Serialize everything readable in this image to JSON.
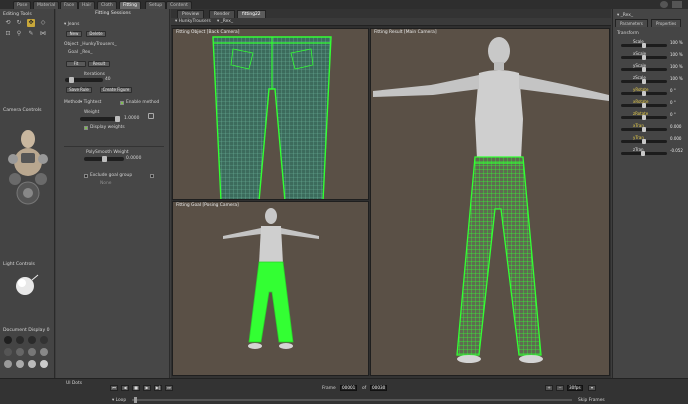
{
  "top_tabs": [
    "Pose",
    "Material",
    "Face",
    "Hair",
    "Cloth",
    "Fitting",
    "Setup",
    "Content"
  ],
  "active_top_tab": "Fitting",
  "left_panels": {
    "editing_tools": "Editing Tools",
    "camera_controls": "Camera Controls",
    "light_controls": "Light Controls",
    "document_display": "Document Display",
    "document_display_badge": "0"
  },
  "fitting": {
    "title": "Fitting Sessions",
    "session_name": "Jeans",
    "new_label": "New",
    "delete_label": "Delete",
    "object_label": "Object",
    "object_value": "_HunkyTrousers_",
    "goal_label": "Goal",
    "goal_value": "_Rex_",
    "fit_label": "Fit",
    "result_label": "Result",
    "iterations_label": "Iterations",
    "iterations_value": "40",
    "save_rule_label": "Save Rule",
    "create_figure_label": "Create Figure",
    "method_label": "Method",
    "method_value": "Tightest",
    "enable_method_label": "Enable method",
    "weight_label": "Weight",
    "weight_value": "1.0000",
    "display_weights_label": "Display weights",
    "polysmooth_label": "PolySmooth Weight",
    "polysmooth_value": "0.0000",
    "exclude_goal_label": "Exclude goal group",
    "none_label": "None"
  },
  "viewport": {
    "tabs": [
      "Preview",
      "Render",
      "fitting22"
    ],
    "active_tab": "fitting22",
    "object_selector": "HunkyTrousers",
    "figure_selector": "_Rex_",
    "views": {
      "object_view": "Fitting Object [Back Camera]",
      "result_view": "Fitting Result [Main Camera]",
      "goal_view": "Fitting Goal [Posing Camera]"
    }
  },
  "right_panel": {
    "figure": "_Rex_",
    "tabs": [
      "Parameters",
      "Properties"
    ],
    "section": "Transform",
    "params": [
      {
        "name": "Scale",
        "value": "100 %",
        "level": 0.5,
        "highlight": false
      },
      {
        "name": "xScale",
        "value": "100 %",
        "level": 0.5,
        "highlight": false
      },
      {
        "name": "yScale",
        "value": "100 %",
        "level": 0.5,
        "highlight": false
      },
      {
        "name": "zScale",
        "value": "100 %",
        "level": 0.5,
        "highlight": false
      },
      {
        "name": "yRotate",
        "value": "0 °",
        "level": 0.5,
        "highlight": true
      },
      {
        "name": "xRotate",
        "value": "0 °",
        "level": 0.5,
        "highlight": true
      },
      {
        "name": "zRotate",
        "value": "0 °",
        "level": 0.5,
        "highlight": true
      },
      {
        "name": "xTran",
        "value": "0.000",
        "level": 0.5,
        "highlight": true
      },
      {
        "name": "yTran",
        "value": "0.000",
        "level": 0.5,
        "highlight": true
      },
      {
        "name": "zTran",
        "value": "-0.052",
        "level": 0.48,
        "highlight": false
      }
    ]
  },
  "timeline": {
    "frame_label": "Frame",
    "frame_value": "00001",
    "of_label": "of",
    "total_frames": "00030",
    "loop_label": "Loop",
    "skip_frames_label": "Skip Frames",
    "ui_dots_label": "UI Dots",
    "fps_label": "30fps"
  },
  "colors": {
    "accent_gold": "#c9a83a",
    "mesh_green": "#33ff33",
    "viewport_bg": "#5a5046"
  }
}
